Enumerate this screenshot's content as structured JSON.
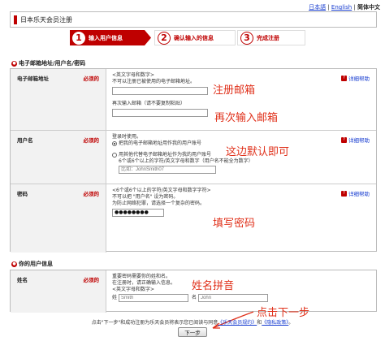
{
  "lang_bar": {
    "japanese": "日本語",
    "english": "English",
    "current": "简体中文"
  },
  "header": {
    "title": "日本乐天会员注册"
  },
  "steps": [
    {
      "num": "1",
      "label": "输入用户信息"
    },
    {
      "num": "2",
      "label": "确认输入的信息"
    },
    {
      "num": "3",
      "label": "完成注册"
    }
  ],
  "section1": {
    "title": "电子邮箱地址/用户名/密码"
  },
  "email": {
    "label": "电子邮箱地址",
    "required": "必须的",
    "hint1": "<英文字母和数字>",
    "hint2": "不可以注册已被使用的电子邮箱地址。",
    "confirm_hint": "再次输入邮箱（请不要复制粘贴）",
    "help": "详细帮助",
    "value": "",
    "confirm_value": ""
  },
  "username": {
    "label": "用户名",
    "required": "必须的",
    "intro": "登录时使用。",
    "option1": "把我的电子邮箱地址用作我的用户账号",
    "option2": "用其他代替电子邮箱地址作为我的用户账号",
    "hint": "6个或6个以上的字符/英文字母和数字（用户名不能全为数字）",
    "placeholder": "比如：JohnSmith07",
    "help": "详细帮助"
  },
  "password": {
    "label": "密码",
    "required": "必须的",
    "hint1": "<6个或6个以上的字符/英文字母和数字字符>",
    "hint2": "不可以把 \"用户名\" 设为密码。",
    "hint3": "为防止网络犯罪，请选择一个复杂的密码。",
    "value": "●●●●●●●●",
    "help": "详细帮助"
  },
  "section2": {
    "title": "你的用户信息"
  },
  "name": {
    "label": "姓名",
    "required": "必须的",
    "hint1": "重要密码需要你的姓和名。",
    "hint2": "在注册时，请正确输入信息。",
    "hint3": "<英文字母和数字>",
    "last_placeholder": "Smith",
    "first_placeholder": "John",
    "last_label": "姓",
    "first_label": "名"
  },
  "annotations": {
    "register_email": "注册邮箱",
    "reenter_email": "再次输入邮箱",
    "default_ok": "这边默认即可",
    "fill_password": "填写密码",
    "name_pinyin": "姓名拼音",
    "click_next": "点击下一步"
  },
  "footer": {
    "text_before": "点击\"下一步\"和成功注册为乐天会员将表示您已阅读与同意",
    "link1": "《乐天会员规约》",
    "and": "和",
    "link2": "《隐私政策》",
    "text_after": "。",
    "next_button": "下一步"
  },
  "colors": {
    "brand_red": "#bf0000",
    "annotation_red": "#e0311b",
    "link_blue": "#1a3fd1"
  }
}
